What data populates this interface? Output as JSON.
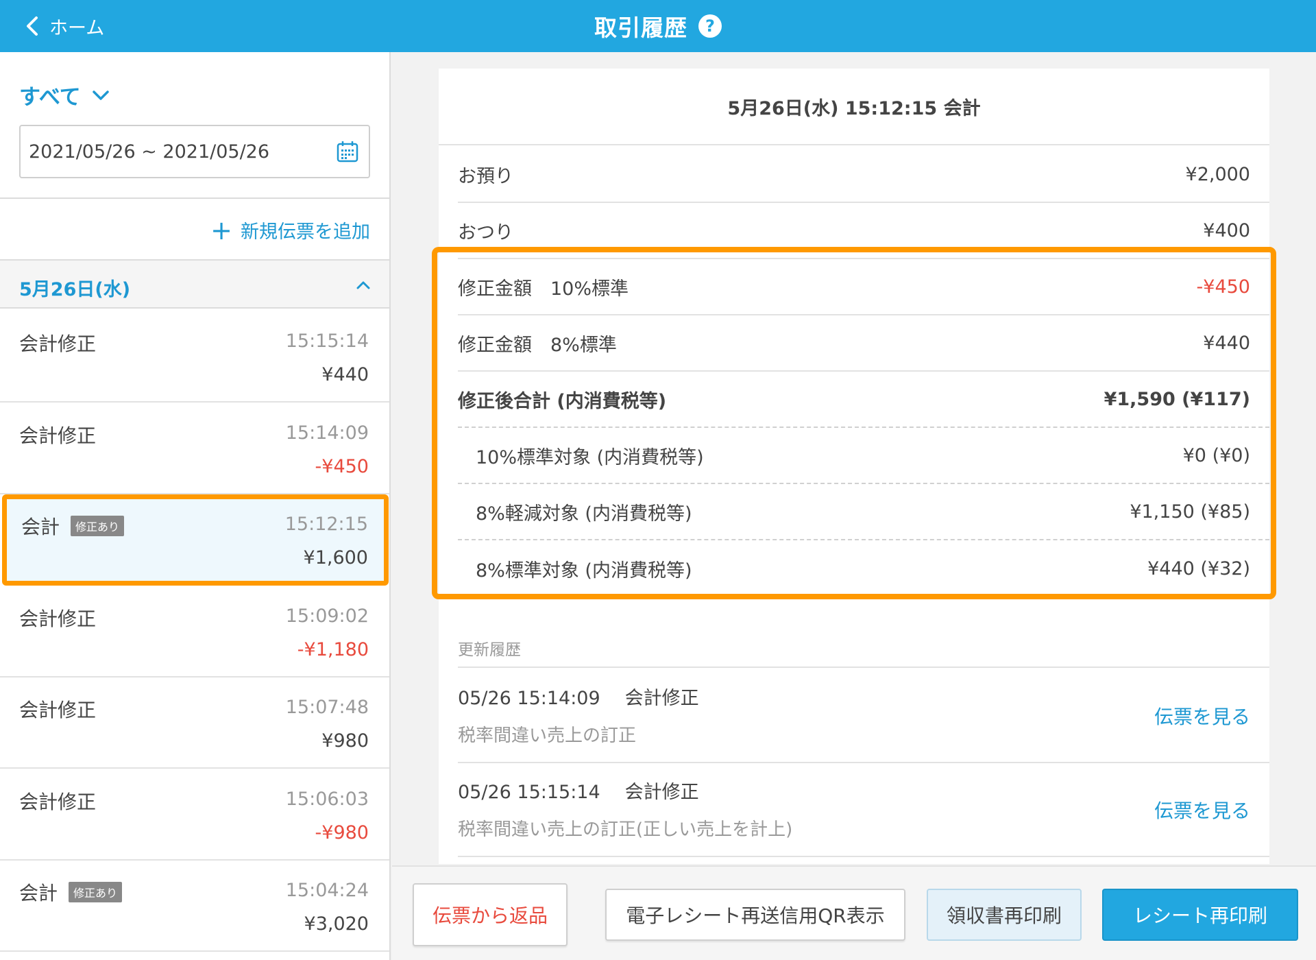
{
  "header": {
    "back_label": "ホーム",
    "title": "取引履歴",
    "help_label": "?"
  },
  "sidebar": {
    "filter_label": "すべて",
    "date_range": "2021/05/26 ~ 2021/05/26",
    "add_slip_label": "新規伝票を追加",
    "date_group": "5月26日(水)",
    "transactions": [
      {
        "label": "会計修正",
        "badge": "",
        "time": "15:15:14",
        "amount": "¥440",
        "negative": false
      },
      {
        "label": "会計修正",
        "badge": "",
        "time": "15:14:09",
        "amount": "-¥450",
        "negative": true
      },
      {
        "label": "会計",
        "badge": "修正あり",
        "time": "15:12:15",
        "amount": "¥1,600",
        "negative": false,
        "selected": true
      },
      {
        "label": "会計修正",
        "badge": "",
        "time": "15:09:02",
        "amount": "-¥1,180",
        "negative": true
      },
      {
        "label": "会計修正",
        "badge": "",
        "time": "15:07:48",
        "amount": "¥980",
        "negative": false
      },
      {
        "label": "会計修正",
        "badge": "",
        "time": "15:06:03",
        "amount": "-¥980",
        "negative": true
      },
      {
        "label": "会計",
        "badge": "修正あり",
        "time": "15:04:24",
        "amount": "¥3,020",
        "negative": false
      }
    ]
  },
  "detail": {
    "title": "5月26日(水) 15:12:15 会計",
    "rows": [
      {
        "label": "お預り",
        "value": "¥2,000"
      },
      {
        "label": "おつり",
        "value": "¥400"
      },
      {
        "label": "修正金額　10%標準",
        "value": "-¥450"
      },
      {
        "label": "修正金額　8%標準",
        "value": "¥440"
      },
      {
        "label": "修正後合計 (内消費税等)",
        "value": "¥1,590 (¥117)"
      },
      {
        "label": "10%標準対象 (内消費税等)",
        "value": "¥0 (¥0)"
      },
      {
        "label": "8%軽減対象 (内消費税等)",
        "value": "¥1,150 (¥85)"
      },
      {
        "label": "8%標準対象 (内消費税等)",
        "value": "¥440 (¥32)"
      }
    ],
    "history_title": "更新履歴",
    "history": [
      {
        "datetime": "05/26 15:14:09",
        "type": "会計修正",
        "note": "税率間違い売上の訂正",
        "link": "伝票を見る"
      },
      {
        "datetime": "05/26 15:15:14",
        "type": "会計修正",
        "note": "税率間違い売上の訂正(正しい売上を計上)",
        "link": "伝票を見る"
      }
    ]
  },
  "toolbar": {
    "return_label": "伝票から返品",
    "qr_label": "電子レシート再送信用QR表示",
    "receipt_label": "領収書再印刷",
    "reprint_label": "レシート再印刷"
  },
  "colors": {
    "brand": "#22a7e0",
    "highlight": "#ff9900",
    "negative": "#e84a3d"
  }
}
